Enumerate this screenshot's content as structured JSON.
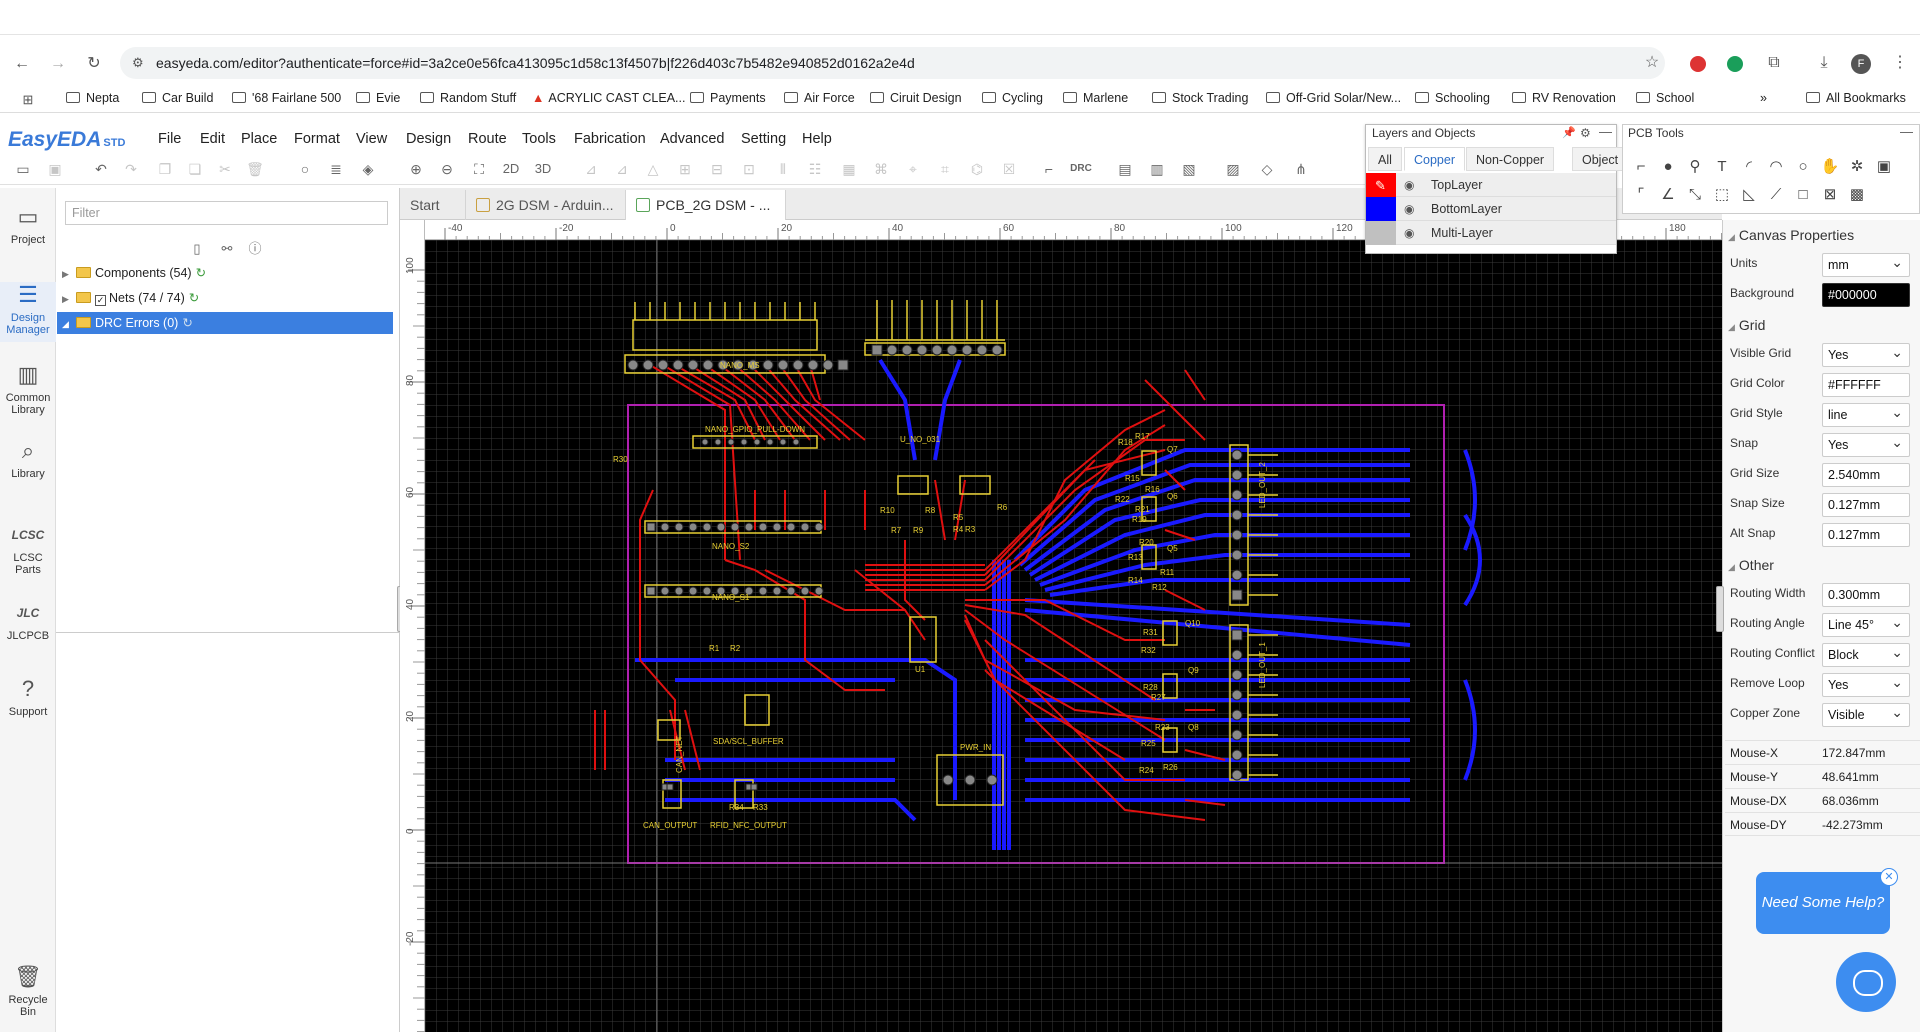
{
  "browser": {
    "url": "easyeda.com/editor?authenticate=force#id=3a2ce0e56fca413095c1d58c13f4507b|f226d403c7b5482e940852d0162a2e4d",
    "profile_initial": "F",
    "bookmarks": [
      "Nepta",
      "Car Build",
      "'68 Fairlane 500",
      "Evie",
      "Random Stuff",
      "ACRYLIC CAST CLEA...",
      "Payments",
      "Air Force",
      "Ciruit Design",
      "Cycling",
      "Marlene",
      "Stock Trading",
      "Off-Grid Solar/New...",
      "Schooling",
      "RV Renovation",
      "School"
    ],
    "all_bookmarks": "All Bookmarks"
  },
  "app": {
    "logo": "EasyEDA",
    "logo_suffix": "STD",
    "menus": [
      "File",
      "Edit",
      "Place",
      "Format",
      "View",
      "Design",
      "Route",
      "Tools",
      "Fabrication",
      "Advanced",
      "Setting",
      "Help"
    ],
    "toolbar": {
      "view2d": "2D",
      "view3d": "3D",
      "drc": "DRC"
    }
  },
  "leftnav": [
    {
      "label": "Project",
      "icon": "folder-icon"
    },
    {
      "label": "Design\nManager",
      "icon": "list-icon"
    },
    {
      "label": "Common\nLibrary",
      "icon": "chip-icon"
    },
    {
      "label": "Library",
      "icon": "search-library-icon"
    },
    {
      "label": "LCSC\nParts",
      "icon": "lcsc-icon"
    },
    {
      "label": "JLCPCB",
      "icon": "jlc-icon"
    },
    {
      "label": "Support",
      "icon": "help-icon"
    },
    {
      "label": "Recycle\nBin",
      "icon": "trash-icon"
    }
  ],
  "design_manager": {
    "filter_placeholder": "Filter",
    "tree": [
      {
        "label": "Components (54)"
      },
      {
        "label": "Nets (74 / 74)"
      },
      {
        "label": "DRC Errors (0)"
      }
    ]
  },
  "tabs": [
    {
      "label": "Start"
    },
    {
      "label": "2G DSM - Arduin..."
    },
    {
      "label": "PCB_2G DSM - ..."
    }
  ],
  "ruler_top": [
    "-40",
    "-20",
    "0",
    "20",
    "40",
    "60",
    "80",
    "100",
    "120",
    "140",
    "160",
    "180"
  ],
  "ruler_left": [
    "100",
    "80",
    "60",
    "40",
    "20",
    "0",
    "-20"
  ],
  "layers": {
    "title": "Layers and Objects",
    "tabs": [
      "All",
      "Copper",
      "Non-Copper",
      "Object"
    ],
    "rows": [
      {
        "name": "TopLayer",
        "color": "#ff0000"
      },
      {
        "name": "BottomLayer",
        "color": "#0000ff"
      },
      {
        "name": "Multi-Layer",
        "color": "#c0c0c0"
      }
    ]
  },
  "pcb_tools": {
    "title": "PCB Tools"
  },
  "canvas": {
    "labels": [
      "NANO_MS",
      "NANO_GPIO_PULL-DOWN",
      "R30",
      "NANO_S2",
      "NANO_S1",
      "R1",
      "R2",
      "SDA/SCL_BUFFER",
      "CAN_NET",
      "CAN_OUTPUT",
      "RFID_NFC_OUTPUT",
      "R34",
      "R33",
      "U_NO_031",
      "R10",
      "R8",
      "R7",
      "R9",
      "R5",
      "R6",
      "R4",
      "R3",
      "U1",
      "PWR_IN",
      "R17",
      "R18",
      "Q7",
      "R15",
      "R16",
      "R22",
      "R21",
      "Q6",
      "R19",
      "R20",
      "Q5",
      "R13",
      "R14",
      "R12",
      "R11",
      "LED_OUT_2",
      "R31",
      "R32",
      "Q10",
      "R28",
      "R27",
      "Q9",
      "R23",
      "R25",
      "R24",
      "R26",
      "Q8",
      "LED_OUT_1"
    ]
  },
  "properties": {
    "title": "Canvas Properties",
    "units_label": "Units",
    "units": "mm",
    "background_label": "Background",
    "background": "#000000",
    "grid_section": "Grid",
    "visible_grid_label": "Visible Grid",
    "visible_grid": "Yes",
    "grid_color_label": "Grid Color",
    "grid_color": "#FFFFFF",
    "grid_style_label": "Grid Style",
    "grid_style": "line",
    "snap_label": "Snap",
    "snap": "Yes",
    "grid_size_label": "Grid Size",
    "grid_size": "2.540mm",
    "snap_size_label": "Snap Size",
    "snap_size": "0.127mm",
    "alt_snap_label": "Alt Snap",
    "alt_snap": "0.127mm",
    "other_section": "Other",
    "routing_width_label": "Routing Width",
    "routing_width": "0.300mm",
    "routing_angle_label": "Routing Angle",
    "routing_angle": "Line 45°",
    "routing_conflict_label": "Routing Conflict",
    "routing_conflict": "Block",
    "remove_loop_label": "Remove Loop",
    "remove_loop": "Yes",
    "copper_zone_label": "Copper Zone",
    "copper_zone": "Visible"
  },
  "mouse": {
    "x_label": "Mouse-X",
    "x": "172.847mm",
    "y_label": "Mouse-Y",
    "y": "48.641mm",
    "dx_label": "Mouse-DX",
    "dx": "68.036mm",
    "dy_label": "Mouse-DY",
    "dy": "-42.273mm"
  },
  "help": {
    "text": "Need Some Help?"
  }
}
